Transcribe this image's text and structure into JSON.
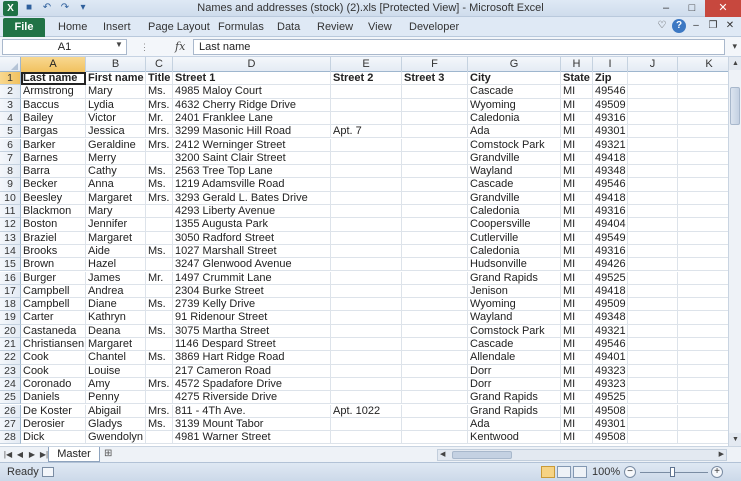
{
  "window": {
    "title": "Names and addresses (stock) (2).xls  [Protected View]  -  Microsoft Excel",
    "logo": "X"
  },
  "ribbon": {
    "file_tab": "File",
    "tabs": [
      "Home",
      "Insert",
      "Page Layout",
      "Formulas",
      "Data",
      "Review",
      "View",
      "Developer"
    ]
  },
  "formula_bar": {
    "name_box": "A1",
    "fx": "fx",
    "content": "Last name"
  },
  "columns": [
    {
      "label": "A"
    },
    {
      "label": "B"
    },
    {
      "label": "C"
    },
    {
      "label": "D"
    },
    {
      "label": "E"
    },
    {
      "label": "F"
    },
    {
      "label": "G"
    },
    {
      "label": "H"
    },
    {
      "label": "I"
    },
    {
      "label": "J"
    },
    {
      "label": "K"
    }
  ],
  "rows": [
    {
      "n": "1",
      "cells": [
        "Last name",
        "First name",
        "Title",
        "Street 1",
        "Street 2",
        "Street 3",
        "City",
        "State",
        "Zip",
        "",
        ""
      ]
    },
    {
      "n": "2",
      "cells": [
        "Armstrong",
        "Mary",
        "Ms.",
        "4985 Maloy Court",
        "",
        "",
        "Cascade",
        "MI",
        "49546",
        "",
        ""
      ]
    },
    {
      "n": "3",
      "cells": [
        "Baccus",
        "Lydia",
        "Mrs.",
        "4632 Cherry Ridge Drive",
        "",
        "",
        "Wyoming",
        "MI",
        "49509",
        "",
        ""
      ]
    },
    {
      "n": "4",
      "cells": [
        "Bailey",
        "Victor",
        "Mr.",
        "2401 Franklee Lane",
        "",
        "",
        "Caledonia",
        "MI",
        "49316",
        "",
        ""
      ]
    },
    {
      "n": "5",
      "cells": [
        "Bargas",
        "Jessica",
        "Mrs.",
        "3299 Masonic Hill Road",
        "Apt. 7",
        "",
        "Ada",
        "MI",
        "49301",
        "",
        ""
      ]
    },
    {
      "n": "6",
      "cells": [
        "Barker",
        "Geraldine",
        "Mrs.",
        "2412 Werninger Street",
        "",
        "",
        "Comstock Park",
        "MI",
        "49321",
        "",
        ""
      ]
    },
    {
      "n": "7",
      "cells": [
        "Barnes",
        "Merry",
        "",
        "3200 Saint Clair Street",
        "",
        "",
        "Grandville",
        "MI",
        "49418",
        "",
        ""
      ]
    },
    {
      "n": "8",
      "cells": [
        "Barra",
        "Cathy",
        "Ms.",
        "2563 Tree Top Lane",
        "",
        "",
        "Wayland",
        "MI",
        "49348",
        "",
        ""
      ]
    },
    {
      "n": "9",
      "cells": [
        "Becker",
        "Anna",
        "Ms.",
        "1219 Adamsville Road",
        "",
        "",
        "Cascade",
        "MI",
        "49546",
        "",
        ""
      ]
    },
    {
      "n": "10",
      "cells": [
        "Beesley",
        "Margaret",
        "Mrs.",
        "3293 Gerald L. Bates Drive",
        "",
        "",
        "Grandville",
        "MI",
        "49418",
        "",
        ""
      ]
    },
    {
      "n": "11",
      "cells": [
        "Blackmon",
        "Mary",
        "",
        "4293 Liberty Avenue",
        "",
        "",
        "Caledonia",
        "MI",
        "49316",
        "",
        ""
      ]
    },
    {
      "n": "12",
      "cells": [
        "Boston",
        "Jennifer",
        "",
        "1355 Augusta Park",
        "",
        "",
        "Coopersville",
        "MI",
        "49404",
        "",
        ""
      ]
    },
    {
      "n": "13",
      "cells": [
        "Braziel",
        "Margaret",
        "",
        "3050 Radford Street",
        "",
        "",
        "Cutlerville",
        "MI",
        "49549",
        "",
        ""
      ]
    },
    {
      "n": "14",
      "cells": [
        "Brooks",
        "Aide",
        "Ms.",
        "1027 Marshall Street",
        "",
        "",
        "Caledonia",
        "MI",
        "49316",
        "",
        ""
      ]
    },
    {
      "n": "15",
      "cells": [
        "Brown",
        "Hazel",
        "",
        "3247 Glenwood Avenue",
        "",
        "",
        "Hudsonville",
        "MI",
        "49426",
        "",
        ""
      ]
    },
    {
      "n": "16",
      "cells": [
        "Burger",
        "James",
        "Mr.",
        "1497 Crummit Lane",
        "",
        "",
        "Grand Rapids",
        "MI",
        "49525",
        "",
        ""
      ]
    },
    {
      "n": "17",
      "cells": [
        "Campbell",
        "Andrea",
        "",
        "2304 Burke Street",
        "",
        "",
        "Jenison",
        "MI",
        "49418",
        "",
        ""
      ]
    },
    {
      "n": "18",
      "cells": [
        "Campbell",
        "Diane",
        "Ms.",
        "2739 Kelly Drive",
        "",
        "",
        "Wyoming",
        "MI",
        "49509",
        "",
        ""
      ]
    },
    {
      "n": "19",
      "cells": [
        "Carter",
        "Kathryn",
        "",
        "91 Ridenour Street",
        "",
        "",
        "Wayland",
        "MI",
        "49348",
        "",
        ""
      ]
    },
    {
      "n": "20",
      "cells": [
        "Castaneda",
        "Deana",
        "Ms.",
        "3075 Martha Street",
        "",
        "",
        "Comstock Park",
        "MI",
        "49321",
        "",
        ""
      ]
    },
    {
      "n": "21",
      "cells": [
        "Christiansen",
        "Margaret",
        "",
        "1146 Despard Street",
        "",
        "",
        "Cascade",
        "MI",
        "49546",
        "",
        ""
      ]
    },
    {
      "n": "22",
      "cells": [
        "Cook",
        "Chantel",
        "Ms.",
        "3869 Hart Ridge Road",
        "",
        "",
        "Allendale",
        "MI",
        "49401",
        "",
        ""
      ]
    },
    {
      "n": "23",
      "cells": [
        "Cook",
        "Louise",
        "",
        "217 Cameron Road",
        "",
        "",
        "Dorr",
        "MI",
        "49323",
        "",
        ""
      ]
    },
    {
      "n": "24",
      "cells": [
        "Coronado",
        "Amy",
        "Mrs.",
        "4572 Spadafore Drive",
        "",
        "",
        "Dorr",
        "MI",
        "49323",
        "",
        ""
      ]
    },
    {
      "n": "25",
      "cells": [
        "Daniels",
        "Penny",
        "",
        "4275 Riverside Drive",
        "",
        "",
        "Grand Rapids",
        "MI",
        "49525",
        "",
        ""
      ]
    },
    {
      "n": "26",
      "cells": [
        "De Koster",
        "Abigail",
        "Mrs.",
        "811 - 4Th Ave.",
        "Apt. 1022",
        "",
        "Grand Rapids",
        "MI",
        "49508",
        "",
        ""
      ]
    },
    {
      "n": "27",
      "cells": [
        "Derosier",
        "Gladys",
        "Ms.",
        "3139 Mount Tabor",
        "",
        "",
        "Ada",
        "MI",
        "49301",
        "",
        ""
      ]
    },
    {
      "n": "28",
      "cells": [
        "Dick",
        "Gwendolyn",
        "",
        "4981 Warner Street",
        "",
        "",
        "Kentwood",
        "MI",
        "49508",
        "",
        ""
      ]
    }
  ],
  "sheet_tabs": [
    "Master"
  ],
  "status": {
    "text": "Ready",
    "zoom": "100%"
  },
  "colors": {
    "file_tab": "#217346",
    "selection_header": "#f1c15f"
  }
}
